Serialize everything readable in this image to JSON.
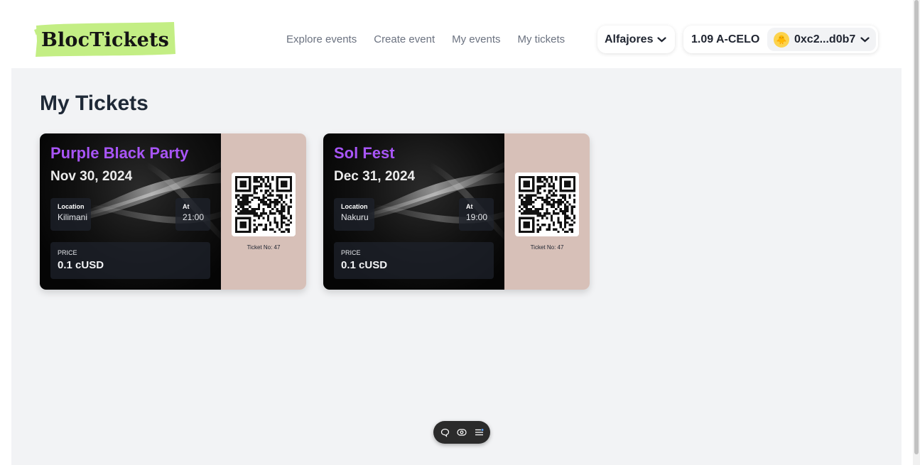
{
  "brand": {
    "name": "BlocTickets",
    "accent": "#c3ee84"
  },
  "nav": {
    "items": [
      {
        "label": "Explore events"
      },
      {
        "label": "Create event"
      },
      {
        "label": "My events"
      },
      {
        "label": "My tickets"
      }
    ]
  },
  "network": {
    "label": "Alfajores",
    "icon": "chevron-down-icon"
  },
  "wallet": {
    "balance": "1.09 A-CELO",
    "address": "0xc2...d0b7",
    "avatar": "🐥"
  },
  "page": {
    "title": "My Tickets"
  },
  "tickets": [
    {
      "title": "Purple Black Party",
      "date": "Nov 30, 2024",
      "location_label": "Location",
      "location": "Kilimani",
      "time_label": "At",
      "time": "21:00",
      "price_label": "PRICE",
      "price": "0.1 cUSD",
      "ticket_no": "Ticket No: 47"
    },
    {
      "title": "Sol Fest",
      "date": "Dec 31, 2024",
      "location_label": "Location",
      "location": "Nakuru",
      "time_label": "At",
      "time": "19:00",
      "price_label": "PRICE",
      "price": "0.1 cUSD",
      "ticket_no": "Ticket No: 47"
    }
  ],
  "colors": {
    "title_purple": "#a855f7",
    "stub_bg": "#d7c0b8",
    "page_bg": "#f2f3f5"
  },
  "toolbar_icons": [
    "comment-icon",
    "eye-icon",
    "settings-list-icon"
  ]
}
